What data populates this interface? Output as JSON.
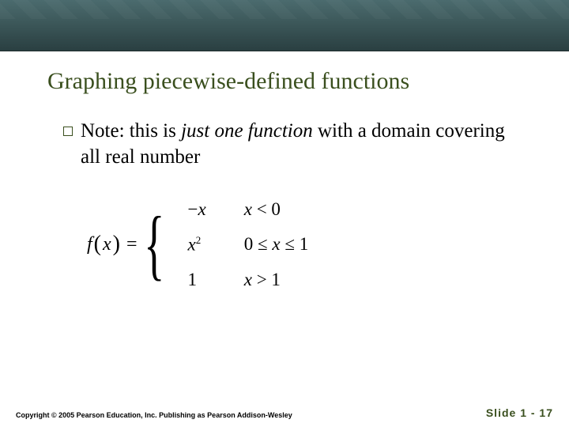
{
  "title": "Graphing piecewise-defined functions",
  "bullet": {
    "lead": "Note:",
    "mid_italic": "just one function",
    "pre": " this is ",
    "post": " with a domain covering all real number"
  },
  "equation": {
    "lhs_f": "f",
    "lhs_x": "x",
    "eq": "=",
    "cases": [
      {
        "expr_neg": "−",
        "expr_var": "x",
        "cond_var": "x",
        "cond_rel": " < 0"
      },
      {
        "expr_var": "x",
        "expr_sup": "2",
        "cond_rel1": "0 ≤ ",
        "cond_var": "x",
        "cond_rel2": " ≤ 1"
      },
      {
        "expr_num": "1",
        "cond_var": "x",
        "cond_rel": " > 1"
      }
    ]
  },
  "footer": {
    "copyright": "Copyright © 2005 Pearson Education, Inc.  Publishing as Pearson Addison-Wesley",
    "slide_label": "Slide 1 - 17"
  }
}
